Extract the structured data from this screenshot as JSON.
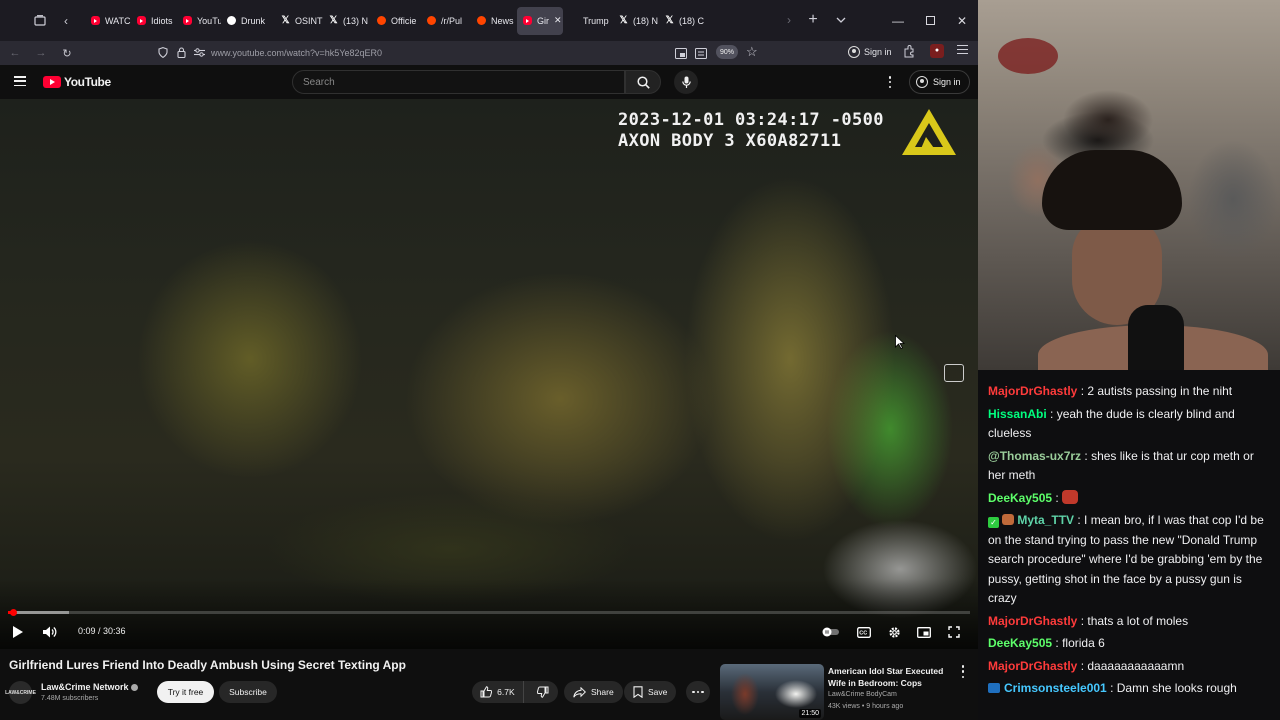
{
  "browser": {
    "tabs": [
      {
        "label": "WATC",
        "icon": "youtube-icon"
      },
      {
        "label": "Idiots",
        "icon": "youtube-icon"
      },
      {
        "label": "YouTu",
        "icon": "youtube-icon"
      },
      {
        "label": "Drunk",
        "icon": "globe-icon"
      },
      {
        "label": "OSINT",
        "icon": "x-icon"
      },
      {
        "label": "(13) N",
        "icon": "x-icon"
      },
      {
        "label": "Officie",
        "icon": "reddit-icon"
      },
      {
        "label": "/r/Pul",
        "icon": "reddit-icon"
      },
      {
        "label": "News",
        "icon": "reddit-icon"
      },
      {
        "label": "Gir",
        "icon": "youtube-icon",
        "active": true
      },
      {
        "label": "Trump",
        "icon": "page-icon"
      },
      {
        "label": "(18) N",
        "icon": "x-icon"
      },
      {
        "label": "(18) C",
        "icon": "x-icon"
      }
    ],
    "url": "www.youtube.com/watch?v=hk5Ye82qER0",
    "zoom": "90%",
    "signin_label": "Sign in"
  },
  "youtube": {
    "logo_text": "YouTube",
    "search_placeholder": "Search",
    "signin_label": "Sign in"
  },
  "video": {
    "osd_line1": "2023-12-01 03:24:17 -0500",
    "osd_line2": "AXON BODY 3 X60A82711",
    "time": "0:09 / 30:36",
    "progress_fraction": 0.005,
    "buffered_fraction": 0.063,
    "title": "Girlfriend Lures Friend Into Deadly Ambush Using Secret Texting App"
  },
  "channel": {
    "avatar_text": "LAW&CRIME",
    "name": "Law&Crime Network",
    "subscribers": "7.48M subscribers",
    "try_label": "Try it free",
    "subscribe_label": "Subscribe"
  },
  "actions": {
    "likes": "6.7K",
    "share_label": "Share",
    "save_label": "Save"
  },
  "recommended": {
    "title": "American Idol Star Executed Wife in Bedroom: Cops",
    "channel": "Law&Crime BodyCam",
    "meta": "43K views • 9 hours ago",
    "duration": "21:50"
  },
  "chat": {
    "messages": [
      {
        "user": "MajorDrGhastly",
        "color": "#ff3b3b",
        "text": "2 autists passing in the niht"
      },
      {
        "user": "HissanAbi",
        "color": "#00ff7f",
        "text": "yeah the dude is clearly blind and clueless"
      },
      {
        "user": "@Thomas-ux7rz",
        "color": "#9acd9a",
        "text": "shes like is that ur cop meth or her meth"
      },
      {
        "user": "DeeKay505",
        "color": "#5dff6a",
        "text": ""
      },
      {
        "user": "Myta_TTV",
        "color": "#5fd3a8",
        "text": "I mean bro, if I was that cop I'd be on the stand trying to pass the new \"Donald Trump search procedure\" where I'd be grabbing 'em by the pussy, getting shot in the face by a pussy gun is crazy"
      },
      {
        "user": "MajorDrGhastly",
        "color": "#ff3b3b",
        "text": "thats a lot of moles"
      },
      {
        "user": "DeeKay505",
        "color": "#5dff6a",
        "text": "florida 6"
      },
      {
        "user": "MajorDrGhastly",
        "color": "#ff3b3b",
        "text": "daaaaaaaaaaamn"
      },
      {
        "user": "Crimsonsteele001",
        "color": "#46c8ff",
        "text": "Damn she looks rough"
      }
    ]
  }
}
